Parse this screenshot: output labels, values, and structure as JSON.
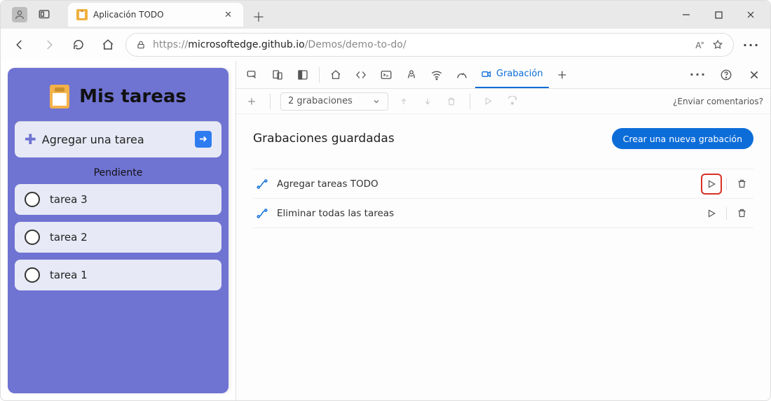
{
  "window": {
    "tab_title": "Aplicación TODO",
    "url_prefix": "https://",
    "url_host_grey": "microsoftedge.github.io",
    "url_path": "/Demos/demo-to-do/"
  },
  "app": {
    "title": "Mis tareas",
    "add_placeholder": "Agregar una tarea",
    "section_label": "Pendiente",
    "tasks": [
      {
        "label": "tarea 3"
      },
      {
        "label": "tarea 2"
      },
      {
        "label": "tarea 1"
      }
    ]
  },
  "devtools": {
    "active_tab": "Grabación",
    "dropdown": "2 grabaciones",
    "feedback": "¿Enviar comentarios?",
    "saved_heading": "Grabaciones guardadas",
    "new_button": "Crear una nueva grabación",
    "recordings": [
      {
        "name": "Agregar tareas TODO"
      },
      {
        "name": "Eliminar todas las tareas"
      }
    ]
  }
}
